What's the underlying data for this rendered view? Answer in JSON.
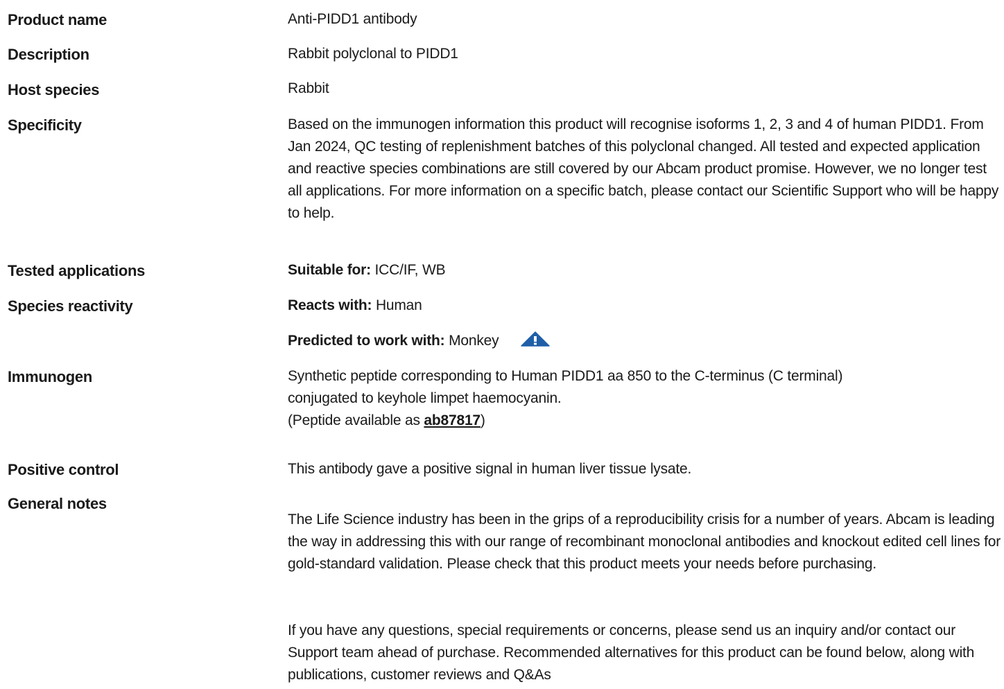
{
  "rows": {
    "product_name": {
      "label": "Product name",
      "value": "Anti-PIDD1 antibody"
    },
    "description": {
      "label": "Description",
      "value": "Rabbit polyclonal to PIDD1"
    },
    "host_species": {
      "label": "Host species",
      "value": "Rabbit"
    },
    "specificity": {
      "label": "Specificity",
      "value": "Based on the immunogen information this product will recognise isoforms 1, 2, 3 and 4 of human PIDD1. From Jan 2024, QC testing of replenishment batches of this polyclonal changed. All tested and expected application and reactive species combinations are still covered by our Abcam product promise. However, we no longer test all applications. For more information on a specific batch, please contact our Scientific Support who will be happy to help."
    },
    "tested_applications": {
      "label": "Tested applications",
      "prefix": "Suitable for:",
      "value": "ICC/IF, WB"
    },
    "species_reactivity": {
      "label": "Species reactivity",
      "reacts_prefix": "Reacts with:",
      "reacts_value": "Human",
      "predicted_prefix": "Predicted to work with:",
      "predicted_value": "Monkey"
    },
    "immunogen": {
      "label": "Immunogen",
      "line1": "Synthetic peptide corresponding to Human PIDD1 aa 850 to the C-terminus (C terminal)",
      "line2": "conjugated to keyhole limpet haemocyanin.",
      "peptide_prefix": "(Peptide available as ",
      "peptide_link": "ab87817",
      "peptide_suffix": ")"
    },
    "positive_control": {
      "label": "Positive control",
      "value": "This antibody gave a positive signal in human liver tissue lysate."
    },
    "general_notes": {
      "label": "General notes",
      "para1": "The Life Science industry has been in the grips of a reproducibility crisis for a number of years. Abcam is leading the way in addressing this with our range of recombinant monoclonal antibodies and knockout edited cell lines for gold-standard validation. Please check that this product meets your needs before purchasing.",
      "para2": "If you have any questions, special requirements or concerns, please send us an inquiry and/or contact our Support team ahead of purchase. Recommended alternatives for this product can be found below, along with publications, customer reviews and Q&As"
    }
  },
  "icons": {
    "predicted_warning": "warning-triangle-icon",
    "accent_color": "#1f5fa8"
  }
}
